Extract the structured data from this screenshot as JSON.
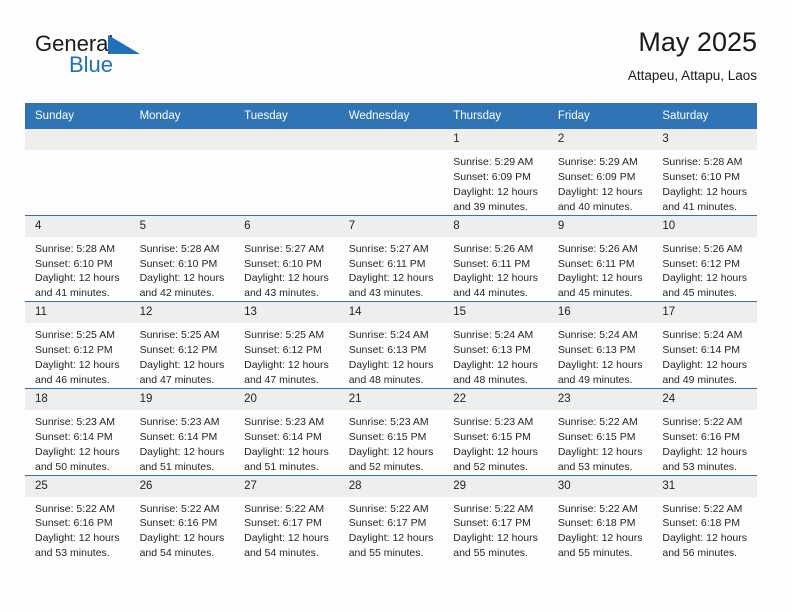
{
  "brand": {
    "name_part1": "General",
    "name_part2": "Blue",
    "flag_color": "#1f71b8"
  },
  "header": {
    "title": "May 2025",
    "subtitle": "Attapeu, Attapu, Laos"
  },
  "theme": {
    "header_bg": "#2f74b5",
    "daynum_bg": "#eeeeee",
    "page_bg": "#fdfdfd",
    "text": "#222222"
  },
  "weekday_headers": [
    "Sunday",
    "Monday",
    "Tuesday",
    "Wednesday",
    "Thursday",
    "Friday",
    "Saturday"
  ],
  "weeks": [
    {
      "days": [
        {
          "num": "",
          "sunrise": "",
          "sunset": "",
          "daylight_l1": "",
          "daylight_l2": ""
        },
        {
          "num": "",
          "sunrise": "",
          "sunset": "",
          "daylight_l1": "",
          "daylight_l2": ""
        },
        {
          "num": "",
          "sunrise": "",
          "sunset": "",
          "daylight_l1": "",
          "daylight_l2": ""
        },
        {
          "num": "",
          "sunrise": "",
          "sunset": "",
          "daylight_l1": "",
          "daylight_l2": ""
        },
        {
          "num": "1",
          "sunrise": "Sunrise: 5:29 AM",
          "sunset": "Sunset: 6:09 PM",
          "daylight_l1": "Daylight: 12 hours",
          "daylight_l2": "and 39 minutes."
        },
        {
          "num": "2",
          "sunrise": "Sunrise: 5:29 AM",
          "sunset": "Sunset: 6:09 PM",
          "daylight_l1": "Daylight: 12 hours",
          "daylight_l2": "and 40 minutes."
        },
        {
          "num": "3",
          "sunrise": "Sunrise: 5:28 AM",
          "sunset": "Sunset: 6:10 PM",
          "daylight_l1": "Daylight: 12 hours",
          "daylight_l2": "and 41 minutes."
        }
      ]
    },
    {
      "days": [
        {
          "num": "4",
          "sunrise": "Sunrise: 5:28 AM",
          "sunset": "Sunset: 6:10 PM",
          "daylight_l1": "Daylight: 12 hours",
          "daylight_l2": "and 41 minutes."
        },
        {
          "num": "5",
          "sunrise": "Sunrise: 5:28 AM",
          "sunset": "Sunset: 6:10 PM",
          "daylight_l1": "Daylight: 12 hours",
          "daylight_l2": "and 42 minutes."
        },
        {
          "num": "6",
          "sunrise": "Sunrise: 5:27 AM",
          "sunset": "Sunset: 6:10 PM",
          "daylight_l1": "Daylight: 12 hours",
          "daylight_l2": "and 43 minutes."
        },
        {
          "num": "7",
          "sunrise": "Sunrise: 5:27 AM",
          "sunset": "Sunset: 6:11 PM",
          "daylight_l1": "Daylight: 12 hours",
          "daylight_l2": "and 43 minutes."
        },
        {
          "num": "8",
          "sunrise": "Sunrise: 5:26 AM",
          "sunset": "Sunset: 6:11 PM",
          "daylight_l1": "Daylight: 12 hours",
          "daylight_l2": "and 44 minutes."
        },
        {
          "num": "9",
          "sunrise": "Sunrise: 5:26 AM",
          "sunset": "Sunset: 6:11 PM",
          "daylight_l1": "Daylight: 12 hours",
          "daylight_l2": "and 45 minutes."
        },
        {
          "num": "10",
          "sunrise": "Sunrise: 5:26 AM",
          "sunset": "Sunset: 6:12 PM",
          "daylight_l1": "Daylight: 12 hours",
          "daylight_l2": "and 45 minutes."
        }
      ]
    },
    {
      "days": [
        {
          "num": "11",
          "sunrise": "Sunrise: 5:25 AM",
          "sunset": "Sunset: 6:12 PM",
          "daylight_l1": "Daylight: 12 hours",
          "daylight_l2": "and 46 minutes."
        },
        {
          "num": "12",
          "sunrise": "Sunrise: 5:25 AM",
          "sunset": "Sunset: 6:12 PM",
          "daylight_l1": "Daylight: 12 hours",
          "daylight_l2": "and 47 minutes."
        },
        {
          "num": "13",
          "sunrise": "Sunrise: 5:25 AM",
          "sunset": "Sunset: 6:12 PM",
          "daylight_l1": "Daylight: 12 hours",
          "daylight_l2": "and 47 minutes."
        },
        {
          "num": "14",
          "sunrise": "Sunrise: 5:24 AM",
          "sunset": "Sunset: 6:13 PM",
          "daylight_l1": "Daylight: 12 hours",
          "daylight_l2": "and 48 minutes."
        },
        {
          "num": "15",
          "sunrise": "Sunrise: 5:24 AM",
          "sunset": "Sunset: 6:13 PM",
          "daylight_l1": "Daylight: 12 hours",
          "daylight_l2": "and 48 minutes."
        },
        {
          "num": "16",
          "sunrise": "Sunrise: 5:24 AM",
          "sunset": "Sunset: 6:13 PM",
          "daylight_l1": "Daylight: 12 hours",
          "daylight_l2": "and 49 minutes."
        },
        {
          "num": "17",
          "sunrise": "Sunrise: 5:24 AM",
          "sunset": "Sunset: 6:14 PM",
          "daylight_l1": "Daylight: 12 hours",
          "daylight_l2": "and 49 minutes."
        }
      ]
    },
    {
      "days": [
        {
          "num": "18",
          "sunrise": "Sunrise: 5:23 AM",
          "sunset": "Sunset: 6:14 PM",
          "daylight_l1": "Daylight: 12 hours",
          "daylight_l2": "and 50 minutes."
        },
        {
          "num": "19",
          "sunrise": "Sunrise: 5:23 AM",
          "sunset": "Sunset: 6:14 PM",
          "daylight_l1": "Daylight: 12 hours",
          "daylight_l2": "and 51 minutes."
        },
        {
          "num": "20",
          "sunrise": "Sunrise: 5:23 AM",
          "sunset": "Sunset: 6:14 PM",
          "daylight_l1": "Daylight: 12 hours",
          "daylight_l2": "and 51 minutes."
        },
        {
          "num": "21",
          "sunrise": "Sunrise: 5:23 AM",
          "sunset": "Sunset: 6:15 PM",
          "daylight_l1": "Daylight: 12 hours",
          "daylight_l2": "and 52 minutes."
        },
        {
          "num": "22",
          "sunrise": "Sunrise: 5:23 AM",
          "sunset": "Sunset: 6:15 PM",
          "daylight_l1": "Daylight: 12 hours",
          "daylight_l2": "and 52 minutes."
        },
        {
          "num": "23",
          "sunrise": "Sunrise: 5:22 AM",
          "sunset": "Sunset: 6:15 PM",
          "daylight_l1": "Daylight: 12 hours",
          "daylight_l2": "and 53 minutes."
        },
        {
          "num": "24",
          "sunrise": "Sunrise: 5:22 AM",
          "sunset": "Sunset: 6:16 PM",
          "daylight_l1": "Daylight: 12 hours",
          "daylight_l2": "and 53 minutes."
        }
      ]
    },
    {
      "days": [
        {
          "num": "25",
          "sunrise": "Sunrise: 5:22 AM",
          "sunset": "Sunset: 6:16 PM",
          "daylight_l1": "Daylight: 12 hours",
          "daylight_l2": "and 53 minutes."
        },
        {
          "num": "26",
          "sunrise": "Sunrise: 5:22 AM",
          "sunset": "Sunset: 6:16 PM",
          "daylight_l1": "Daylight: 12 hours",
          "daylight_l2": "and 54 minutes."
        },
        {
          "num": "27",
          "sunrise": "Sunrise: 5:22 AM",
          "sunset": "Sunset: 6:17 PM",
          "daylight_l1": "Daylight: 12 hours",
          "daylight_l2": "and 54 minutes."
        },
        {
          "num": "28",
          "sunrise": "Sunrise: 5:22 AM",
          "sunset": "Sunset: 6:17 PM",
          "daylight_l1": "Daylight: 12 hours",
          "daylight_l2": "and 55 minutes."
        },
        {
          "num": "29",
          "sunrise": "Sunrise: 5:22 AM",
          "sunset": "Sunset: 6:17 PM",
          "daylight_l1": "Daylight: 12 hours",
          "daylight_l2": "and 55 minutes."
        },
        {
          "num": "30",
          "sunrise": "Sunrise: 5:22 AM",
          "sunset": "Sunset: 6:18 PM",
          "daylight_l1": "Daylight: 12 hours",
          "daylight_l2": "and 55 minutes."
        },
        {
          "num": "31",
          "sunrise": "Sunrise: 5:22 AM",
          "sunset": "Sunset: 6:18 PM",
          "daylight_l1": "Daylight: 12 hours",
          "daylight_l2": "and 56 minutes."
        }
      ]
    }
  ]
}
